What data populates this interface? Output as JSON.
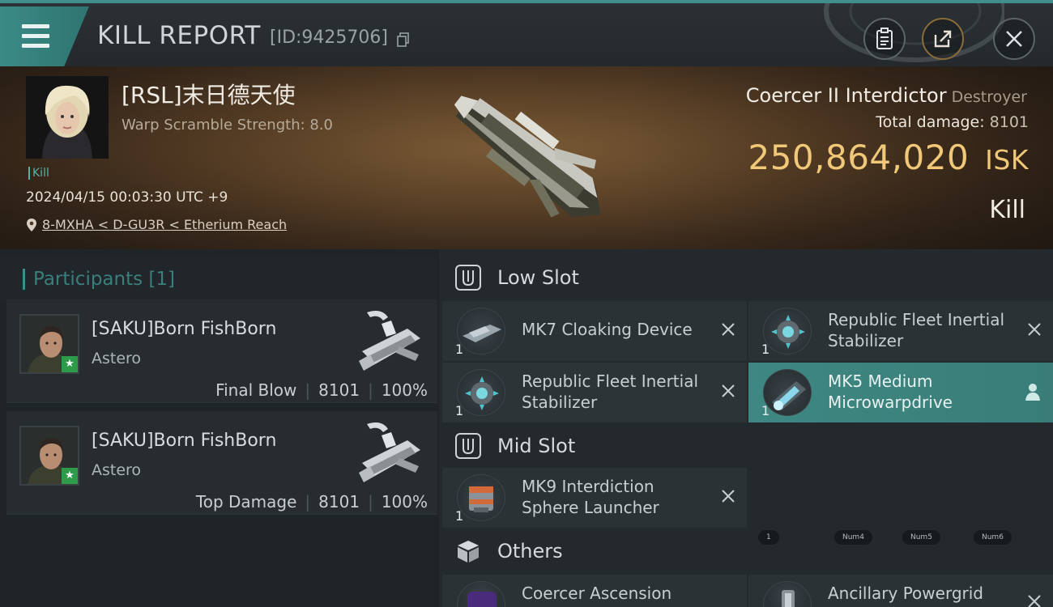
{
  "header": {
    "title": "KILL REPORT",
    "report_id": "[ID:9425706]",
    "buttons": {
      "report_icon": "clipboard-icon",
      "share_icon": "share-icon",
      "close_icon": "close-icon"
    }
  },
  "victim": {
    "name": "[RSL]末日德天使",
    "scramble": "Warp Scramble Strength: 8.0",
    "tag": "Kill",
    "timestamp": "2024/04/15 00:03:30 UTC +9",
    "location": "8-MXHA < D-GU3R < Etherium Reach",
    "ship_name": "Coercer II Interdictor",
    "ship_class": "Destroyer",
    "total_damage_label": "Total damage:",
    "total_damage": "8101",
    "isk_value": "250,864,020",
    "isk_unit": "ISK",
    "result": "Kill"
  },
  "participants": {
    "label": "Participants [1]",
    "items": [
      {
        "name": "[SAKU]Born FishBorn",
        "ship": "Astero",
        "role": "Final Blow",
        "damage": "8101",
        "percent": "100%"
      },
      {
        "name": "[SAKU]Born FishBorn",
        "ship": "Astero",
        "role": "Top Damage",
        "damage": "8101",
        "percent": "100%"
      }
    ]
  },
  "slots": {
    "low": {
      "label": "Low Slot",
      "items": [
        {
          "name": "MK7 Cloaking Device",
          "qty": "1"
        },
        {
          "name": "Republic Fleet Inertial Stabilizer",
          "qty": "1"
        },
        {
          "name": "Republic Fleet Inertial Stabilizer",
          "qty": "1"
        },
        {
          "name": "MK5 Medium Microwarpdrive",
          "qty": "1"
        }
      ]
    },
    "mid": {
      "label": "Mid Slot",
      "items": [
        {
          "name": "MK9 Interdiction Sphere Launcher",
          "qty": "1"
        }
      ]
    },
    "others": {
      "label": "Others",
      "items": [
        {
          "name": "Coercer Ascension"
        },
        {
          "name": "Ancillary Powergrid"
        }
      ]
    }
  },
  "hud_keys": [
    "1",
    "Num4",
    "Num5",
    "Num6"
  ],
  "colors": {
    "accent": "#3b8f8a",
    "isk": "#f0c878",
    "star": "#2e9b4b"
  }
}
